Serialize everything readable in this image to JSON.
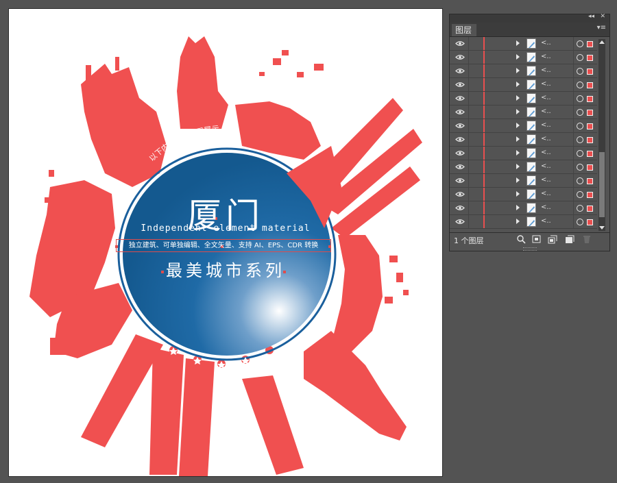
{
  "canvas": {
    "title_main": "厦门",
    "title_en": "Independent element material",
    "title_desc": "独立建筑、可单独编辑、全文矢量、支持 AI、EPS、CDR 转换",
    "title_sub": "最美城市系列",
    "arc_text": "以下内容为预览图展示",
    "colors": {
      "artwork": "#f05050",
      "circle_dark": "#1a5f9c",
      "circle_light": "#ffffff"
    }
  },
  "layers_panel": {
    "tab_label": "图层",
    "layer_name": "<..",
    "layer_count_label": "1 个图层",
    "layer_color": "#ea4f4f",
    "rows": 14,
    "thumb_icon": "vector-shape-thumbnail",
    "footer_icons": [
      "locate-object-icon",
      "make-clipping-mask-icon",
      "new-sublayer-icon",
      "new-layer-icon",
      "delete-layer-icon"
    ]
  }
}
